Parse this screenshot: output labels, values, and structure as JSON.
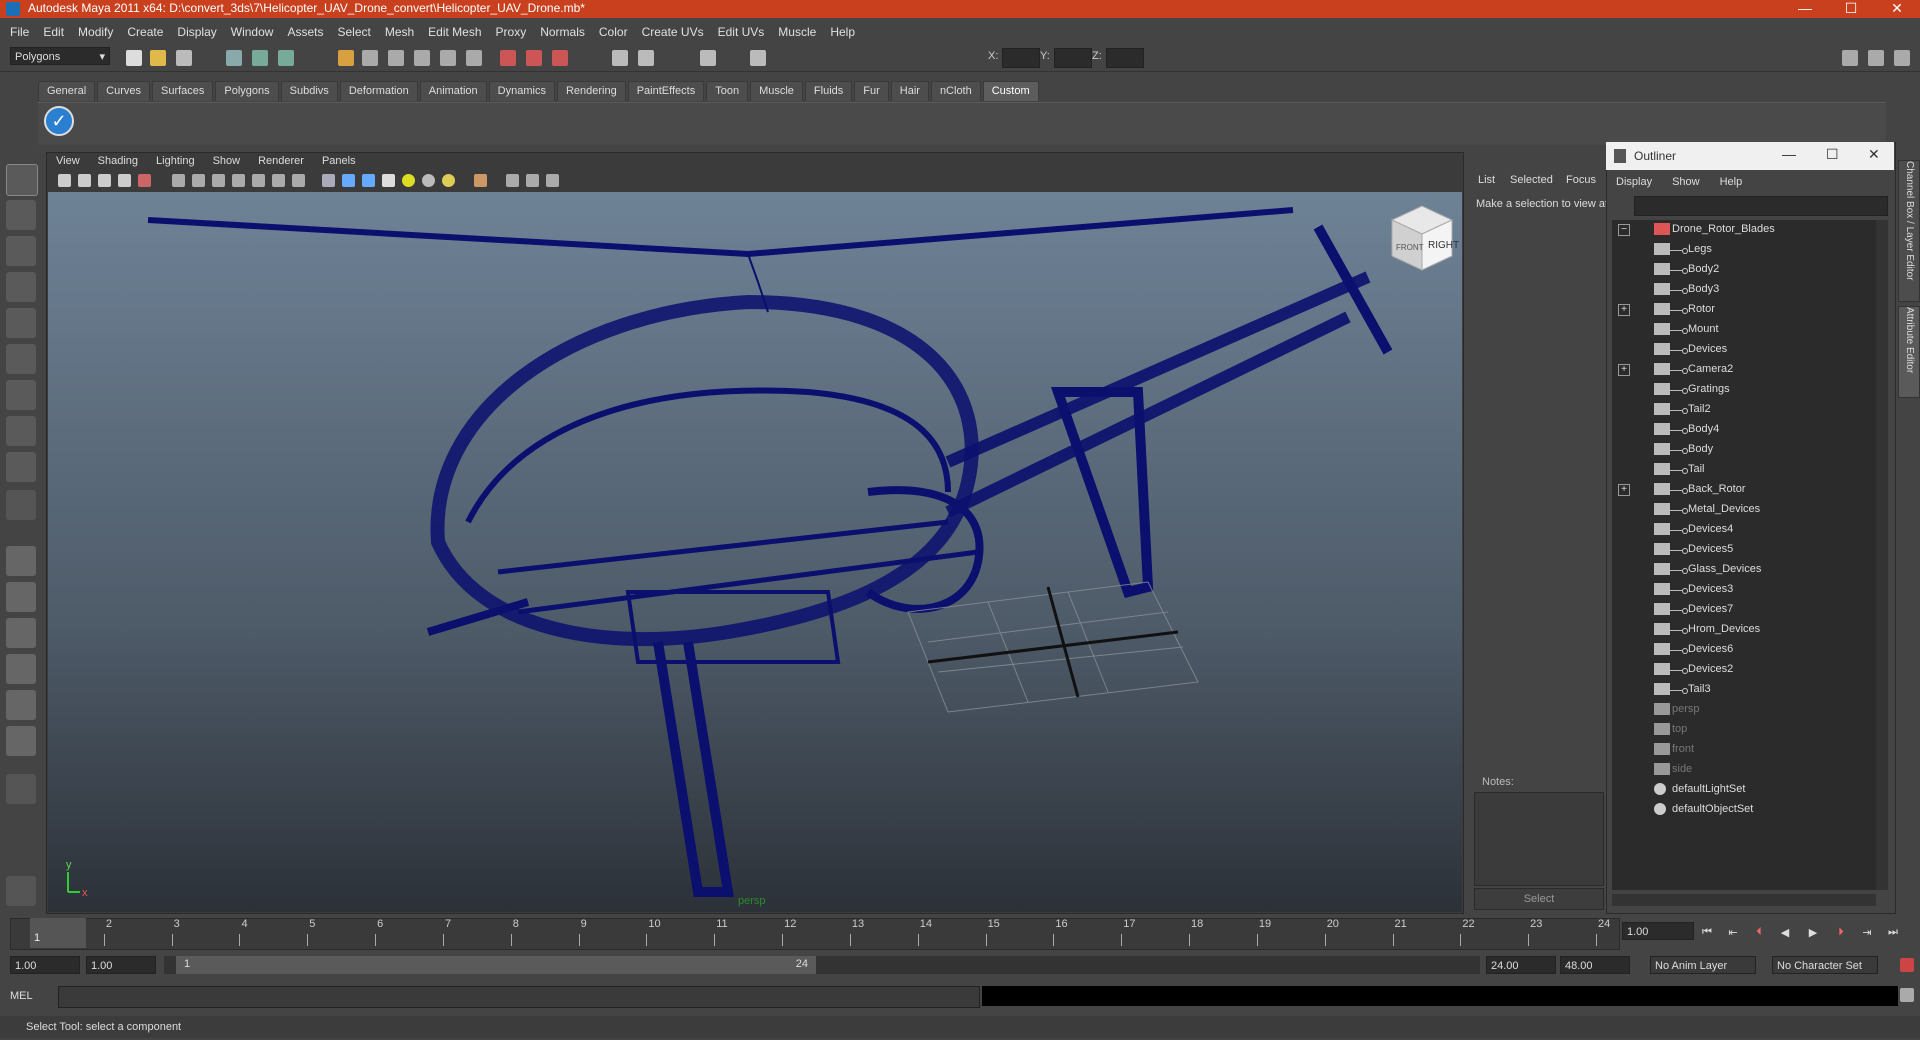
{
  "titlebar": {
    "title": "Autodesk Maya 2011 x64: D:\\convert_3ds\\7\\Helicopter_UAV_Drone_convert\\Helicopter_UAV_Drone.mb*",
    "minimize": "—",
    "maximize": "☐",
    "close": "✕"
  },
  "menubar": [
    "File",
    "Edit",
    "Modify",
    "Create",
    "Display",
    "Window",
    "Assets",
    "Select",
    "Mesh",
    "Edit Mesh",
    "Proxy",
    "Normals",
    "Color",
    "Create UVs",
    "Edit UVs",
    "Muscle",
    "Help"
  ],
  "statusline": {
    "mode": "Polygons",
    "x_label": "X:",
    "y_label": "Y:",
    "z_label": "Z:"
  },
  "shelf": {
    "tabs": [
      "General",
      "Curves",
      "Surfaces",
      "Polygons",
      "Subdivs",
      "Deformation",
      "Animation",
      "Dynamics",
      "Rendering",
      "PaintEffects",
      "Toon",
      "Muscle",
      "Fluids",
      "Fur",
      "Hair",
      "nCloth",
      "Custom"
    ],
    "active": "Custom"
  },
  "viewport": {
    "menu": [
      "View",
      "Shading",
      "Lighting",
      "Show",
      "Renderer",
      "Panels"
    ],
    "camera_label": "persp",
    "viewcube_front": "FRONT",
    "viewcube_right": "RIGHT",
    "axis_x": "x",
    "axis_y": "y"
  },
  "channelbox": {
    "tabs": [
      "List",
      "Selected",
      "Focus"
    ],
    "message": "Make a selection to view at",
    "notes_label": "Notes:",
    "select_button": "Select",
    "side_tab1": "Channel Box / Layer Editor",
    "side_tab2": "Attribute Editor"
  },
  "outliner": {
    "title": "Outliner",
    "menu": [
      "Display",
      "Show",
      "Help"
    ],
    "items": [
      {
        "label": "Drone_Rotor_Blades",
        "expanded": true,
        "kind": "root"
      },
      {
        "label": "Legs"
      },
      {
        "label": "Body2"
      },
      {
        "label": "Body3"
      },
      {
        "label": "Rotor",
        "expandable": true
      },
      {
        "label": "Mount"
      },
      {
        "label": "Devices"
      },
      {
        "label": "Camera2",
        "expandable": true
      },
      {
        "label": "Gratings"
      },
      {
        "label": "Tail2"
      },
      {
        "label": "Body4"
      },
      {
        "label": "Body"
      },
      {
        "label": "Tail"
      },
      {
        "label": "Back_Rotor",
        "expandable": true
      },
      {
        "label": "Metal_Devices"
      },
      {
        "label": "Devices4"
      },
      {
        "label": "Devices5"
      },
      {
        "label": "Glass_Devices"
      },
      {
        "label": "Devices3"
      },
      {
        "label": "Devices7"
      },
      {
        "label": "Hrom_Devices"
      },
      {
        "label": "Devices6"
      },
      {
        "label": "Devices2"
      },
      {
        "label": "Tail3"
      },
      {
        "label": "persp",
        "kind": "camera"
      },
      {
        "label": "top",
        "kind": "camera"
      },
      {
        "label": "front",
        "kind": "camera"
      },
      {
        "label": "side",
        "kind": "camera"
      },
      {
        "label": "defaultLightSet",
        "kind": "set"
      },
      {
        "label": "defaultObjectSet",
        "kind": "set"
      }
    ]
  },
  "timeline": {
    "ticks": [
      "1",
      "2",
      "3",
      "4",
      "5",
      "6",
      "7",
      "8",
      "9",
      "10",
      "11",
      "12",
      "13",
      "14",
      "15",
      "16",
      "17",
      "18",
      "19",
      "20",
      "21",
      "22",
      "23",
      "24"
    ],
    "current_frame": "1",
    "current_time": "1.00"
  },
  "range": {
    "start": "1.00",
    "start2": "1.00",
    "slider_min": "1",
    "slider_max": "24",
    "end": "24.00",
    "end2": "48.00",
    "anim_layer": "No Anim Layer",
    "char_set": "No Character Set"
  },
  "commandline": {
    "label": "MEL"
  },
  "helpline": {
    "text": "Select Tool: select a component"
  }
}
